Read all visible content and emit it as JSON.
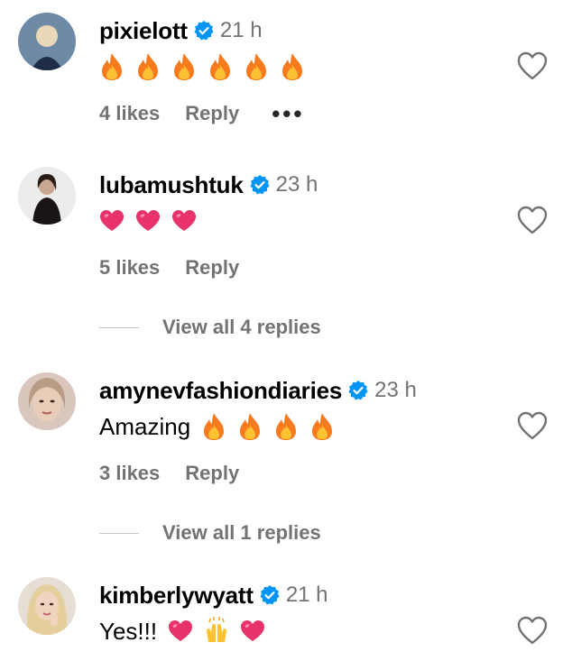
{
  "comments": [
    {
      "username": "pixielott",
      "time": "21 h",
      "text": "",
      "emojis": [
        "fire",
        "fire",
        "fire",
        "fire",
        "fire",
        "fire"
      ],
      "likes": "4 likes",
      "reply": "Reply",
      "more": "•••"
    },
    {
      "username": "lubamushtuk",
      "time": "23 h",
      "text": "",
      "emojis": [
        "heart",
        "heart",
        "heart"
      ],
      "likes": "5 likes",
      "reply": "Reply",
      "view_replies": "View all 4 replies"
    },
    {
      "username": "amynevfashiondiaries",
      "time": "23 h",
      "text": "Amazing",
      "emojis": [
        "fire",
        "fire",
        "fire",
        "fire"
      ],
      "likes": "3 likes",
      "reply": "Reply",
      "view_replies": "View all 1 replies"
    },
    {
      "username": "kimberlywyatt",
      "time": "21 h",
      "text": "Yes!!!",
      "emojis": [
        "heart",
        "raised-hands",
        "heart"
      ],
      "likes": "",
      "reply": ""
    }
  ],
  "colors": {
    "verified": "#0095f6",
    "muted_text": "#737373",
    "fire_outer": "#f77a1c",
    "fire_inner": "#ffc233",
    "heart_emoji": "#e8336a"
  }
}
